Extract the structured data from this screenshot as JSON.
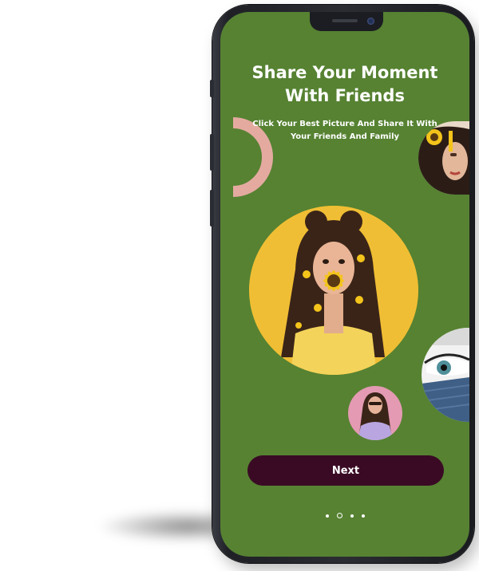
{
  "onboarding": {
    "title": "Share Your Moment\nWith Friends",
    "subtitle": "Click Your Best Picture And Share It With\nYour Friends And Family",
    "next_label": "Next",
    "page_count": 4,
    "active_page": 2
  },
  "colors": {
    "screen_bg": "#568232",
    "button_bg": "#3a0a24",
    "arc": "#e4aaa0",
    "phone_frame": "#1f2026"
  },
  "photos": [
    {
      "name": "main-photo",
      "subject": "woman-with-sunflower"
    },
    {
      "name": "top-right-photo",
      "subject": "woman-with-sunflower-hair"
    },
    {
      "name": "eye-photo",
      "subject": "blue-eye-closeup"
    },
    {
      "name": "small-photo",
      "subject": "woman-in-pink"
    }
  ]
}
